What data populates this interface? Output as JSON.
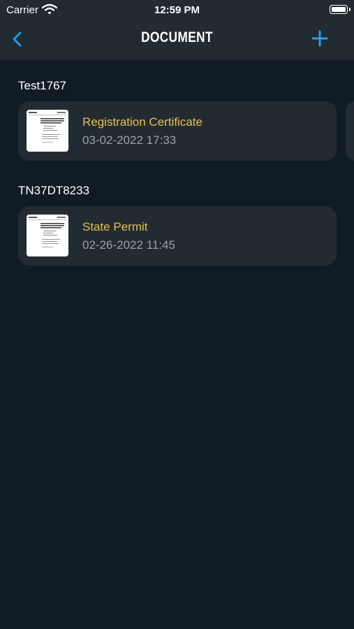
{
  "status": {
    "carrier": "Carrier",
    "time": "12:59 PM"
  },
  "nav": {
    "title": "DOCUMENT",
    "back_icon": "chevron-left-icon",
    "add_icon": "plus-icon"
  },
  "colors": {
    "accent": "#1da1f2",
    "doc_title": "#e9bf49",
    "background": "#111b25",
    "card": "#222b32",
    "date": "#9aa0a6"
  },
  "groups": [
    {
      "title": "Test1767",
      "documents": [
        {
          "name": "Registration Certificate",
          "date": "03-02-2022 17:33"
        }
      ]
    },
    {
      "title": "TN37DT8233",
      "documents": [
        {
          "name": "State Permit",
          "date": "02-26-2022 11:45"
        }
      ]
    }
  ]
}
